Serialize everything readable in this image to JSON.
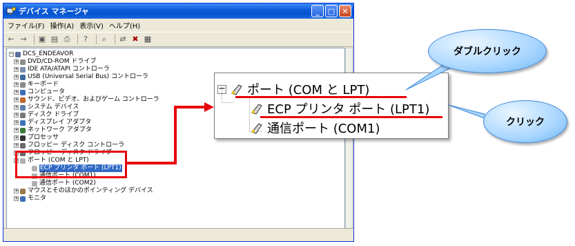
{
  "window": {
    "title": "デバイス マネージャ",
    "menu": [
      "ファイル(F)",
      "操作(A)",
      "表示(V)",
      "ヘルプ(H)"
    ],
    "toolbar_icons": [
      "back-icon",
      "forward-icon",
      "view-icon",
      "properties-icon",
      "print-icon",
      "help-icon",
      "scan-icon",
      "update-icon",
      "uninstall-icon",
      "disable-icon"
    ]
  },
  "tree": {
    "root": "DCS_ENDEAVOR",
    "items": [
      "DVD/CD-ROM ドライブ",
      "IDE ATA/ATAPI コントローラ",
      "USB (Universal Serial Bus) コントローラ",
      "キーボード",
      "コンピュータ",
      "サウンド、ビデオ、およびゲーム コントローラ",
      "システム デバイス",
      "ディスク ドライブ",
      "ディスプレイ アダプタ",
      "ネットワーク アダプタ",
      "プロセッサ",
      "フロッピー ディスク コントローラ",
      "フロッピー ディスク ドライブ",
      "ポート (COM と LPT)",
      "ECP プリンタ ポート (LPT1)",
      "通信ポート (COM1)",
      "通信ポート (COM2)",
      "マウスとそのほかのポインティング デバイス",
      "モニタ"
    ]
  },
  "zoom": {
    "port": "ポート (COM と LPT)",
    "ecp": "ECP プリンタ ポート (LPT1)",
    "com1": "通信ポート (COM1)"
  },
  "callouts": {
    "double_click": "ダブルクリック",
    "click": "クリック"
  },
  "colors": {
    "highlight": "#e8000a",
    "selection": "#316ac5",
    "title_bar": "#0453cf"
  }
}
